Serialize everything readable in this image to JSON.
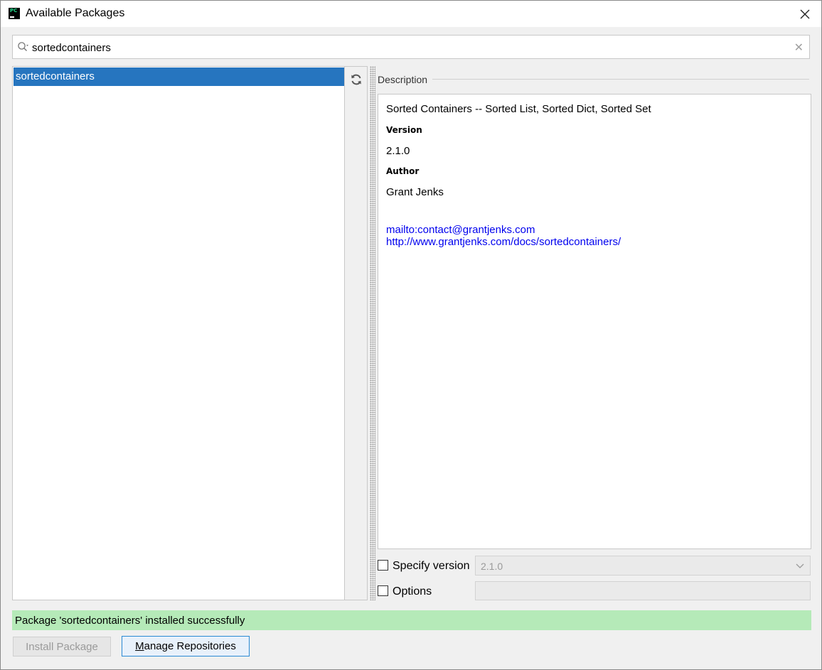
{
  "window": {
    "title": "Available Packages",
    "app_icon_text": "PC"
  },
  "search": {
    "value": "sortedcontainers"
  },
  "packages": {
    "items": [
      {
        "name": "sortedcontainers",
        "selected": true
      }
    ]
  },
  "description": {
    "section_label": "Description",
    "summary": "Sorted Containers -- Sorted List, Sorted Dict, Sorted Set",
    "version_heading": "Version",
    "version": "2.1.0",
    "author_heading": "Author",
    "author": "Grant Jenks",
    "links": [
      "mailto:contact@grantjenks.com",
      "http://www.grantjenks.com/docs/sortedcontainers/"
    ]
  },
  "options": {
    "specify_version_label": "Specify version",
    "specify_version_checked": false,
    "version_value": "2.1.0",
    "options_label": "Options",
    "options_checked": false,
    "options_value": ""
  },
  "status": {
    "message": "Package 'sortedcontainers' installed successfully",
    "color": "#b5eab8"
  },
  "buttons": {
    "install_label": "Install Package",
    "manage_label_mnemonic": "M",
    "manage_label_rest": "anage Repositories"
  },
  "colors": {
    "selection": "#2675bf",
    "link": "#0000ee",
    "focus_border": "#2a8ad4"
  },
  "icons": {
    "app": "pycharm-icon",
    "close": "close-icon",
    "search": "search-icon",
    "clear": "clear-icon",
    "refresh": "refresh-icon",
    "dropdown": "chevron-down-icon"
  }
}
